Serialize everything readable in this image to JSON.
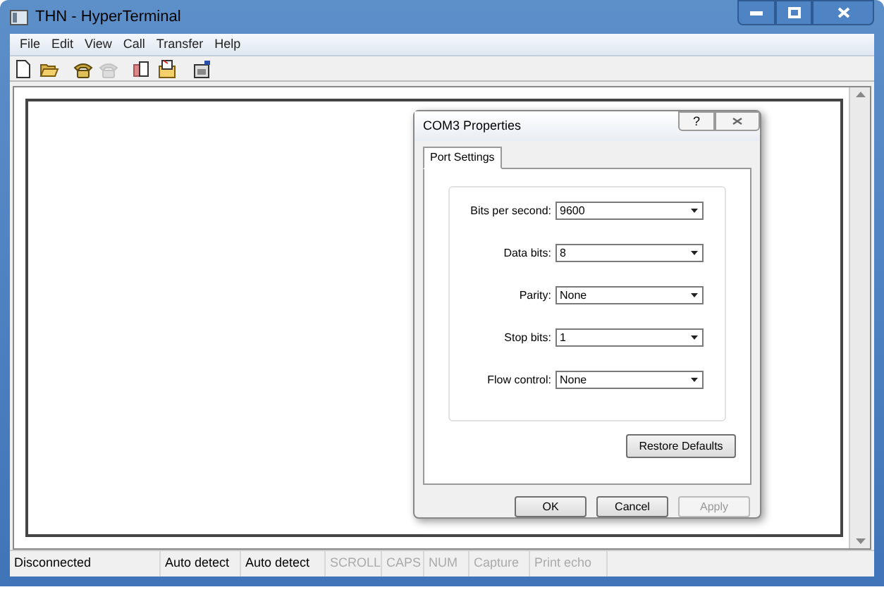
{
  "window": {
    "title": "THN - HyperTerminal"
  },
  "menu": [
    "File",
    "Edit",
    "View",
    "Call",
    "Transfer",
    "Help"
  ],
  "toolbar": [
    {
      "kind": "new",
      "disabled": false
    },
    {
      "kind": "open",
      "disabled": false
    },
    {
      "kind": "call",
      "disabled": false
    },
    {
      "kind": "hangup",
      "disabled": true
    },
    {
      "kind": "send",
      "disabled": false
    },
    {
      "kind": "receive",
      "disabled": false
    },
    {
      "kind": "properties",
      "disabled": false
    }
  ],
  "dialog": {
    "title": "COM3 Properties",
    "help": "?",
    "tabs": [
      {
        "label": "Port Settings",
        "selected": true
      }
    ],
    "fields": [
      {
        "label": "Bits per second:",
        "value": "9600"
      },
      {
        "label": "Data bits:",
        "value": "8"
      },
      {
        "label": "Parity:",
        "value": "None"
      },
      {
        "label": "Stop bits:",
        "value": "1"
      },
      {
        "label": "Flow control:",
        "value": "None"
      }
    ],
    "restore_button": "Restore Defaults",
    "buttons": [
      {
        "label": "OK",
        "disabled": false
      },
      {
        "label": "Cancel",
        "disabled": false
      },
      {
        "label": "Apply",
        "disabled": true
      }
    ]
  },
  "status_bar": [
    {
      "text": "Disconnected",
      "disabled": false
    },
    {
      "text": "Auto detect",
      "disabled": false
    },
    {
      "text": "Auto detect",
      "disabled": false
    },
    {
      "text": "SCROLL",
      "disabled": true
    },
    {
      "text": "CAPS",
      "disabled": true
    },
    {
      "text": "NUM",
      "disabled": true
    },
    {
      "text": "Capture",
      "disabled": true
    },
    {
      "text": "Print echo",
      "disabled": true
    }
  ]
}
